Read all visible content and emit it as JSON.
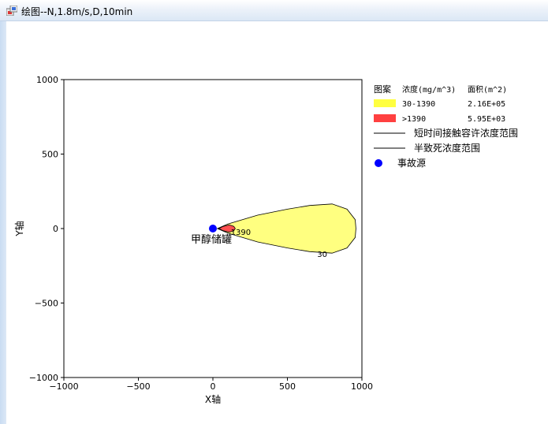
{
  "window": {
    "title": "绘图--N,1.8m/s,D,10min",
    "icon": "app-icon"
  },
  "chart_data": {
    "type": "contour",
    "xlabel": "X轴",
    "ylabel": "Y轴",
    "xlim": [
      -1000,
      1000
    ],
    "ylim": [
      -1000,
      1000
    ],
    "xticks": [
      -1000,
      -500,
      0,
      500,
      1000
    ],
    "yticks": [
      1000,
      500,
      0,
      -500,
      -1000
    ],
    "xtick_labels": [
      "−1000",
      "−500",
      "0",
      "500",
      "1000"
    ],
    "ytick_labels": [
      "1000",
      "500",
      "0",
      "−500",
      "−1000"
    ],
    "grid": false,
    "source": {
      "label": "甲醇储罐",
      "x": 0,
      "y": 0,
      "color": "#0000ff"
    },
    "contours": [
      {
        "level_label": "30",
        "fill": "#ffff80",
        "outline": [
          [
            30,
            0
          ],
          [
            100,
            30
          ],
          [
            300,
            90
          ],
          [
            500,
            130
          ],
          [
            650,
            155
          ],
          [
            800,
            165
          ],
          [
            900,
            130
          ],
          [
            955,
            60
          ],
          [
            960,
            0
          ],
          [
            955,
            -60
          ],
          [
            900,
            -130
          ],
          [
            800,
            -165
          ],
          [
            650,
            -155
          ],
          [
            500,
            -130
          ],
          [
            300,
            -90
          ],
          [
            100,
            -30
          ],
          [
            30,
            0
          ]
        ]
      },
      {
        "level_label": "1390",
        "fill": "#ff5050",
        "outline": [
          [
            40,
            0
          ],
          [
            70,
            15
          ],
          [
            110,
            25
          ],
          [
            140,
            15
          ],
          [
            150,
            0
          ],
          [
            140,
            -15
          ],
          [
            110,
            -25
          ],
          [
            70,
            -15
          ],
          [
            40,
            0
          ]
        ]
      }
    ],
    "legend": {
      "position": "right",
      "headers": {
        "pattern": "图案",
        "concentration": "浓度(mg/m^3)",
        "area": "面积(m^2)"
      },
      "items": [
        {
          "kind": "fill",
          "color": "#ffff40",
          "range": "30-1390",
          "area": "2.16E+05"
        },
        {
          "kind": "fill",
          "color": "#ff4040",
          "range": ">1390",
          "area": "5.95E+03"
        },
        {
          "kind": "line",
          "label": "短时间接触容许浓度范围"
        },
        {
          "kind": "line",
          "label": "半致死浓度范围"
        },
        {
          "kind": "marker",
          "color": "#0000ff",
          "label": "事故源"
        }
      ]
    }
  }
}
